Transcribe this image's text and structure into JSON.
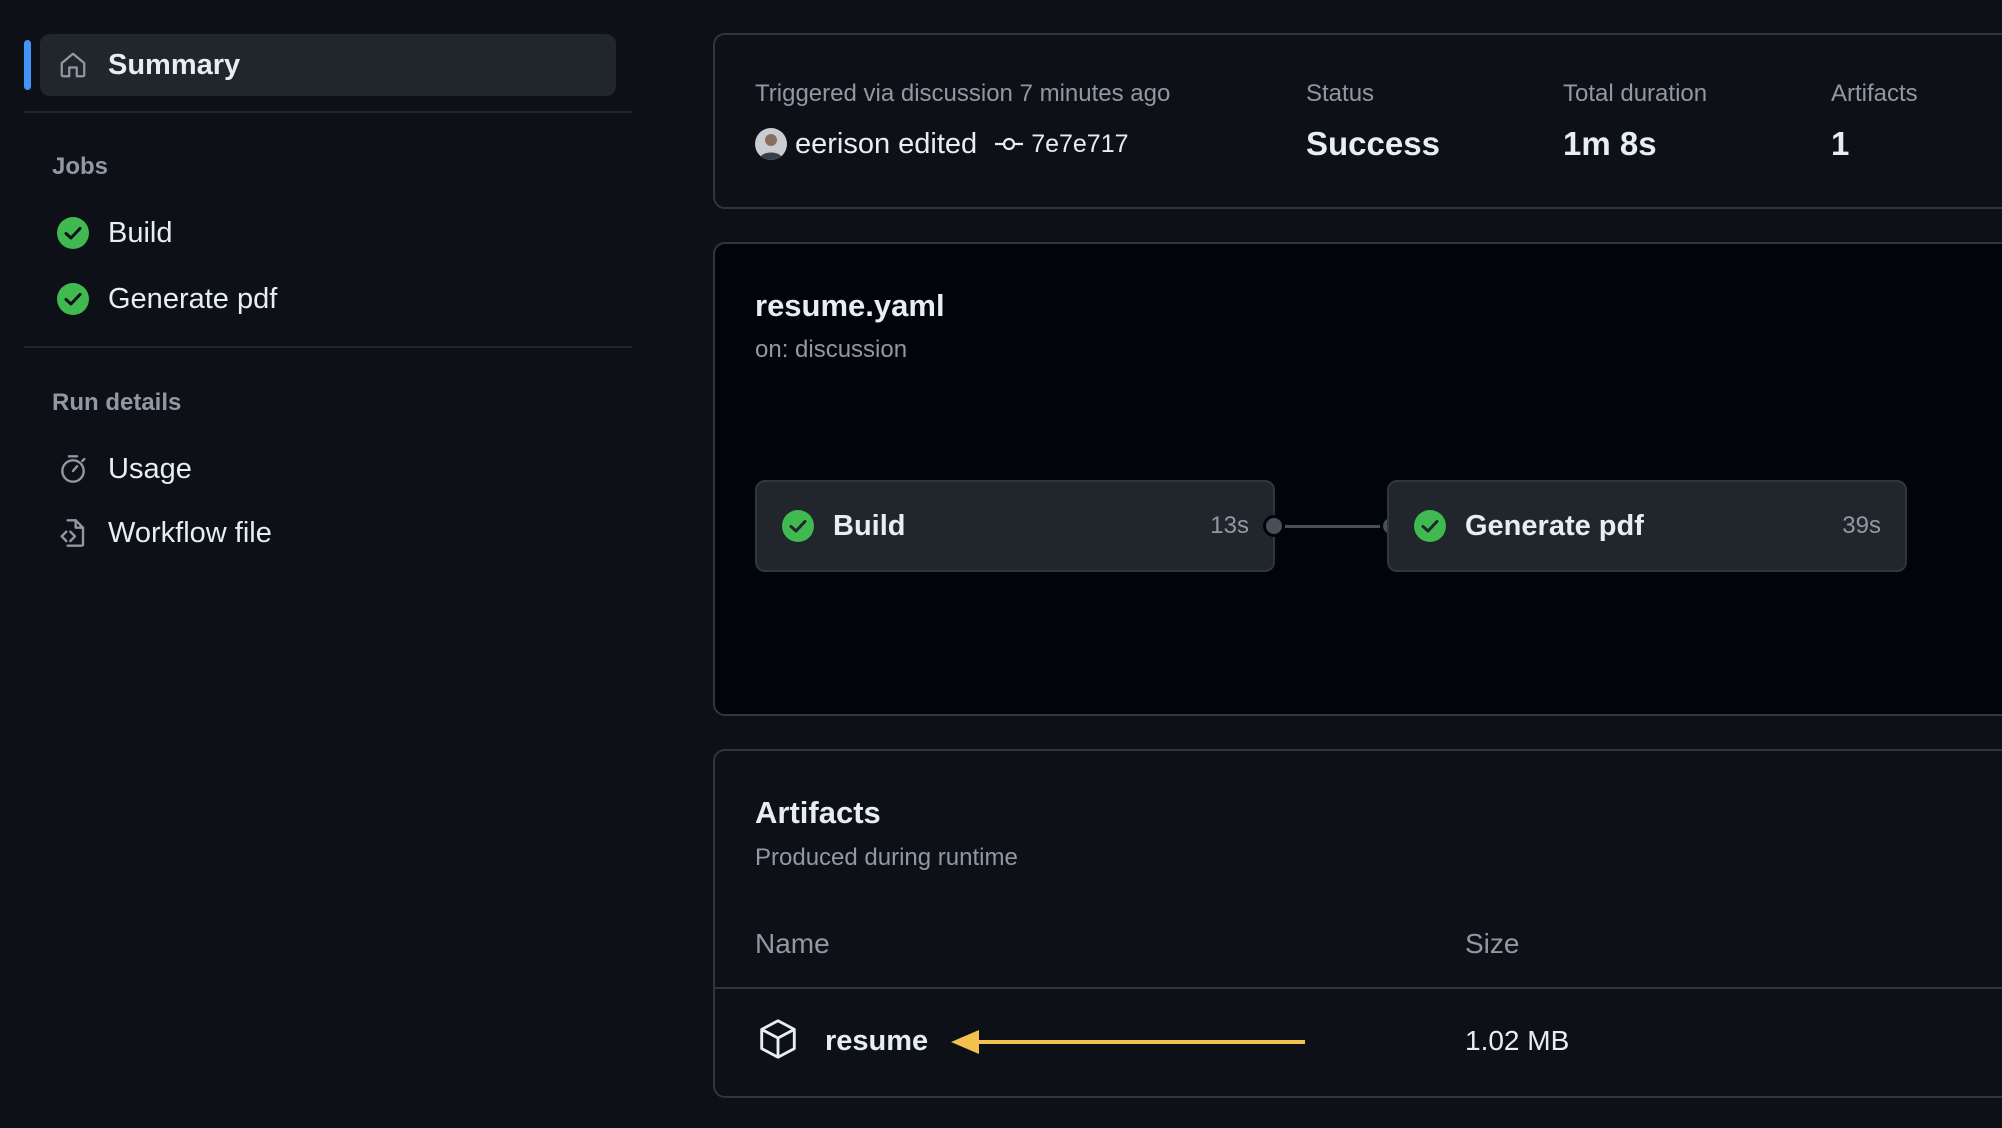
{
  "sidebar": {
    "summary_label": "Summary",
    "jobs_heading": "Jobs",
    "jobs": [
      {
        "label": "Build",
        "status": "success"
      },
      {
        "label": "Generate pdf",
        "status": "success"
      }
    ],
    "run_details_heading": "Run details",
    "run_details": [
      {
        "label": "Usage",
        "icon": "stopwatch-icon"
      },
      {
        "label": "Workflow file",
        "icon": "file-code-icon"
      }
    ]
  },
  "summary": {
    "trigger_text": "Triggered via discussion 7 minutes ago",
    "actor_text": "eerison edited",
    "commit_sha": "7e7e717",
    "status_label": "Status",
    "status_value": "Success",
    "duration_label": "Total duration",
    "duration_value": "1m 8s",
    "artifacts_label": "Artifacts",
    "artifacts_value": "1"
  },
  "workflow": {
    "file_name": "resume.yaml",
    "trigger": "on: discussion",
    "jobs": [
      {
        "name": "Build",
        "duration": "13s",
        "status": "success"
      },
      {
        "name": "Generate pdf",
        "duration": "39s",
        "status": "success"
      }
    ]
  },
  "artifacts": {
    "title": "Artifacts",
    "subtitle": "Produced during runtime",
    "columns": {
      "name": "Name",
      "size": "Size"
    },
    "rows": [
      {
        "name": "resume",
        "size": "1.02 MB"
      }
    ]
  },
  "colors": {
    "background": "#0d1117",
    "accent": "#4493f8",
    "success": "#3fb950",
    "annotation_arrow": "#f2c14e"
  }
}
